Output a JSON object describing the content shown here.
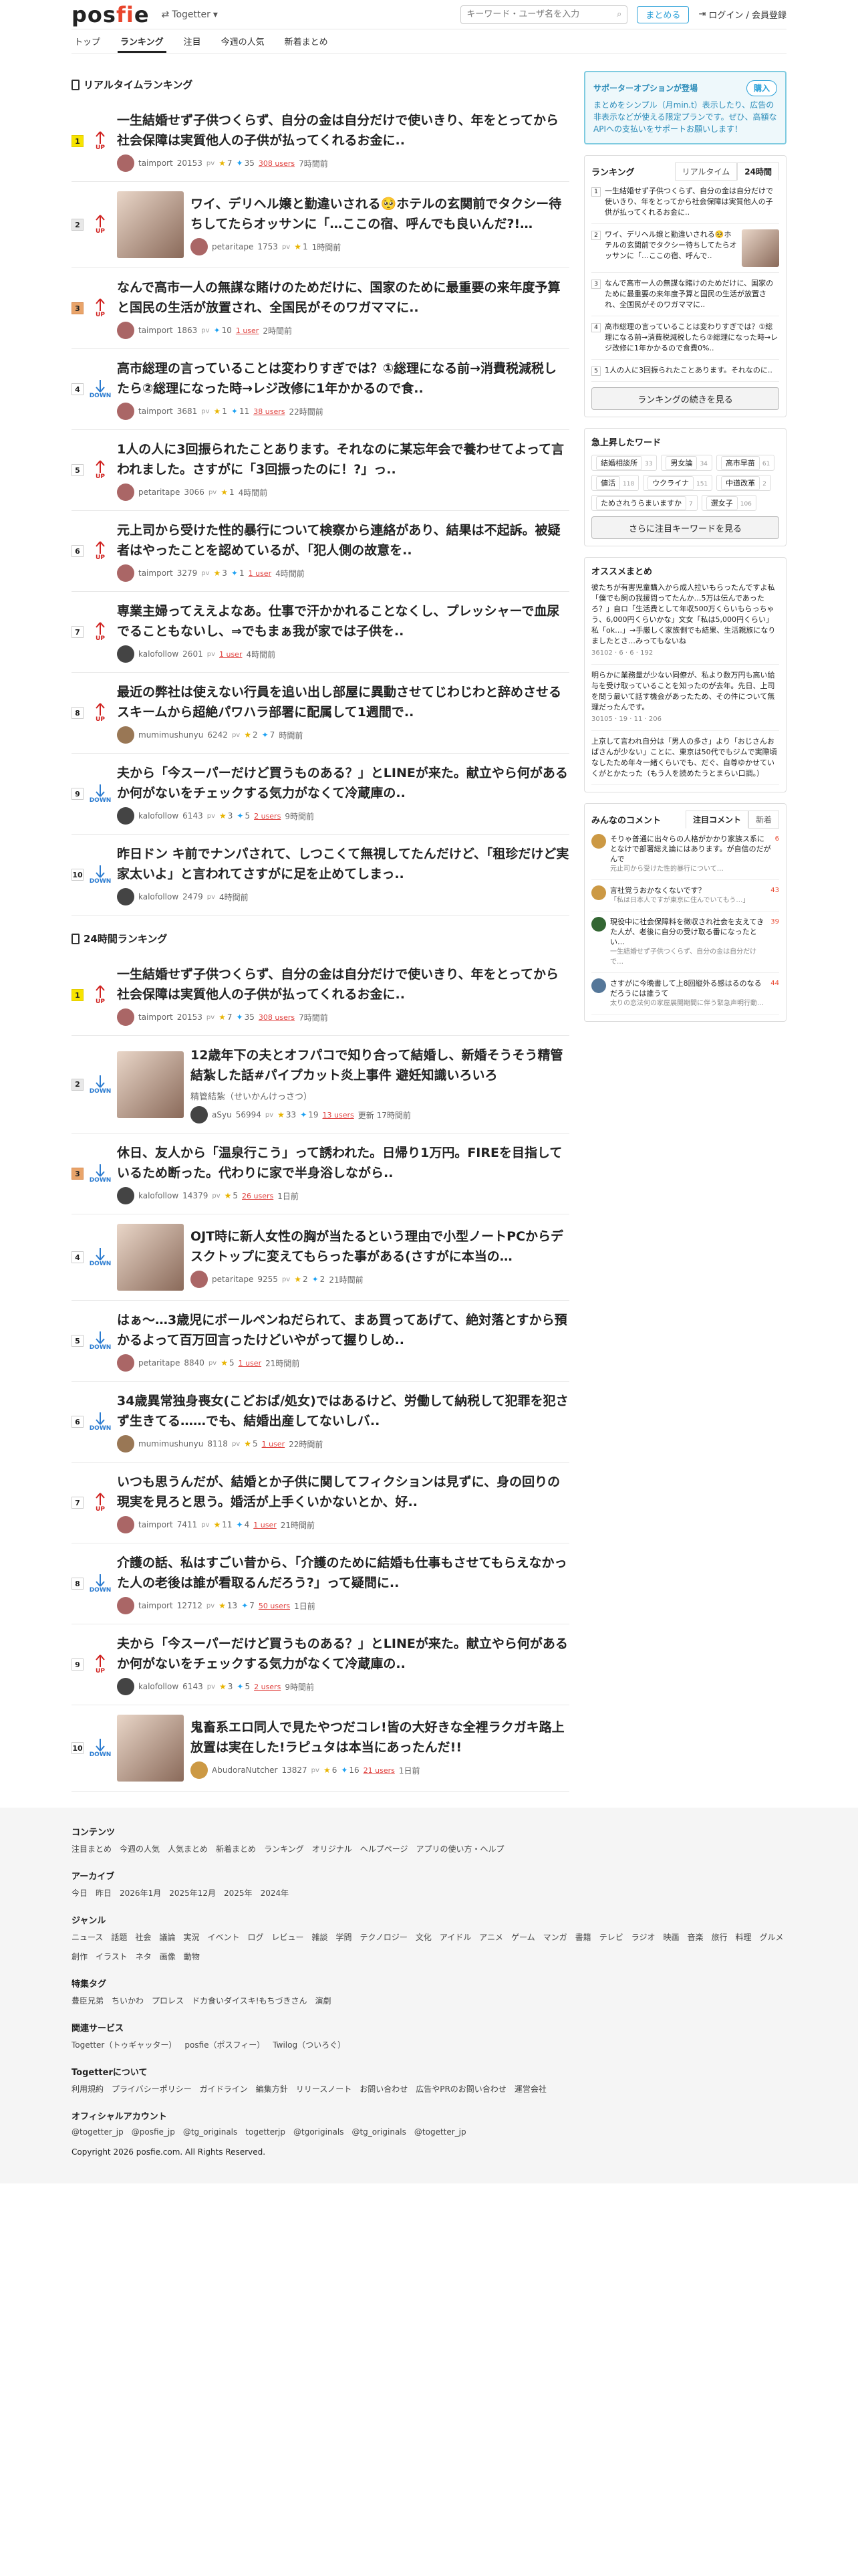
{
  "header": {
    "logo": "posfie",
    "togetter_label": "Togetter",
    "search_placeholder": "キーワード・ユーザ名を入力",
    "matome_button": "まとめる",
    "login_label": "ログイン / 会員登録"
  },
  "nav": [
    "トップ",
    "ランキング",
    "注目",
    "今週の人気",
    "新着まとめ"
  ],
  "realtime": {
    "title": "リアルタイムランキング",
    "items": [
      {
        "rank": "1",
        "dir": "UP",
        "title": "一生結婚せず子供つくらず、自分の金は自分だけで使いきり、年をとってから社会保障は実質他人の子供が払ってくれるお金に..",
        "user": "taimport",
        "pv": "20153",
        "stars": "7",
        "tw": "35",
        "users": "308 users",
        "time": "7時間前",
        "thumb": false
      },
      {
        "rank": "2",
        "dir": "UP",
        "title": "ワイ、デリヘル嬢と勤違いされる🥺ホテルの玄関前でタクシー待ちしてたらオッサンに「…ここの宿、呼んでも良いんだ?!…",
        "user": "petaritape",
        "pv": "1753",
        "stars": "1",
        "tw": "",
        "users": "",
        "time": "1時間前",
        "thumb": true
      },
      {
        "rank": "3",
        "dir": "UP",
        "title": "なんで高市一人の無謀な賭けのためだけに、国家のために最重要の来年度予算と国民の生活が放置され、全国民がそのワガママに..",
        "user": "taimport",
        "pv": "1863",
        "stars": "",
        "tw": "10",
        "users": "1 user",
        "time": "2時間前",
        "thumb": false
      },
      {
        "rank": "4",
        "dir": "DOWN",
        "title": "高市総理の言っていることは変わりすぎでは？①総理になる前→消費税減税したら②総理になった時→レジ改修に1年かかるので食..",
        "user": "taimport",
        "pv": "3681",
        "stars": "1",
        "tw": "11",
        "users": "38 users",
        "time": "22時間前",
        "thumb": false
      },
      {
        "rank": "5",
        "dir": "UP",
        "title": "1人の人に3回振られたことあります。それなのに某忘年会で養わせてよって言われました。さすがに「3回振ったのに！?」っ..",
        "user": "petaritape",
        "pv": "3066",
        "stars": "1",
        "tw": "",
        "users": "",
        "time": "4時間前",
        "thumb": false
      },
      {
        "rank": "6",
        "dir": "UP",
        "title": "元上司から受けた性的暴行について検察から連絡があり、結果は不起訴。被疑者はやったことを認めているが、「犯人側の故意を..",
        "user": "taimport",
        "pv": "3279",
        "stars": "3",
        "tw": "1",
        "users": "1 user",
        "time": "4時間前",
        "thumb": false
      },
      {
        "rank": "7",
        "dir": "UP",
        "title": "専業主婦ってええよなあ。仕事で汗かかれることなくし、プレッシャーで血尿でることもないし、⇒でもまぁ我が家では子供を..",
        "user": "kalofollow",
        "pv": "2601",
        "stars": "",
        "tw": "",
        "users": "1 user",
        "time": "4時間前",
        "thumb": false
      },
      {
        "rank": "8",
        "dir": "UP",
        "title": "最近の弊社は使えない行員を追い出し部屋に異動させてじわじわと辞めさせるスキームから超絶パワハラ部署に配属して1週間で..",
        "user": "mumimushunyu",
        "pv": "6242",
        "stars": "2",
        "tw": "7",
        "users": "",
        "time": "時間前",
        "thumb": false
      },
      {
        "rank": "9",
        "dir": "DOWN",
        "title": "夫から「今スーパーだけど買うものある？」とLINEが来た。献立やら何があるか何がないをチェックする気力がなくて冷蔵庫の..",
        "user": "kalofollow",
        "pv": "6143",
        "stars": "3",
        "tw": "5",
        "users": "2 users",
        "time": "9時間前",
        "thumb": false
      },
      {
        "rank": "10",
        "dir": "DOWN",
        "title": "昨日ドン キ前でナンパされて、しつこくて無視してたんだけど、「租珍だけど実家太いよ」と言われてさすがに足を止めてしまっ..",
        "user": "kalofollow",
        "pv": "2479",
        "stars": "",
        "tw": "",
        "users": "",
        "time": "4時間前",
        "thumb": false
      }
    ]
  },
  "daily": {
    "title": "24時間ランキング",
    "items": [
      {
        "rank": "1",
        "dir": "UP",
        "title": "一生結婚せず子供つくらず、自分の金は自分だけで使いきり、年をとってから社会保障は実質他人の子供が払ってくれるお金に..",
        "user": "taimport",
        "pv": "20153",
        "stars": "7",
        "tw": "35",
        "users": "308 users",
        "time": "7時間前",
        "thumb": false,
        "sub": ""
      },
      {
        "rank": "2",
        "dir": "DOWN",
        "title": "12歳年下の夫とオフパコで知り合って結婚し、新婚そうそう精管結紮した話#パイプカット炎上事件 避妊知識いろいろ",
        "user": "aSyu",
        "pv": "56994",
        "stars": "33",
        "tw": "19",
        "users": "13 users",
        "time": "更新 17時間前",
        "thumb": true,
        "sub": "精管結紮（せいかんけっさつ）"
      },
      {
        "rank": "3",
        "dir": "DOWN",
        "title": "休日、友人から「温泉行こう」って誘われた。日帰り1万円。FIREを目指しているため断った。代わりに家で半身浴しながら..",
        "user": "kalofollow",
        "pv": "14379",
        "stars": "5",
        "tw": "",
        "users": "26 users",
        "time": "1日前",
        "thumb": false,
        "sub": ""
      },
      {
        "rank": "4",
        "dir": "DOWN",
        "title": "OJT時に新人女性の胸が当たるという理由で小型ノートPCからデスクトップに変えてもらった事がある(さすがに本当の…",
        "user": "petaritape",
        "pv": "9255",
        "stars": "2",
        "tw": "2",
        "users": "",
        "time": "21時間前",
        "thumb": true,
        "sub": ""
      },
      {
        "rank": "5",
        "dir": "DOWN",
        "title": "はぁ〜…3歳児にボールペンねだられて、まあ買ってあげて、絶対落とすから預かるよって百万回言ったけどいやがって握りしめ..",
        "user": "petaritape",
        "pv": "8840",
        "stars": "5",
        "tw": "",
        "users": "1 user",
        "time": "21時間前",
        "thumb": false,
        "sub": ""
      },
      {
        "rank": "6",
        "dir": "DOWN",
        "title": "34歳異常独身喪女(こどおば/処女)ではあるけど、労働して納税して犯罪を犯さず生きてる……でも、結婚出産してないしバ..",
        "user": "mumimushunyu",
        "pv": "8118",
        "stars": "5",
        "tw": "",
        "users": "1 user",
        "time": "22時間前",
        "thumb": false,
        "sub": ""
      },
      {
        "rank": "7",
        "dir": "UP",
        "title": "いつも思うんだが、結婚とか子供に関してフィクションは見ずに、身の回りの現実を見ろと思う。婚活が上手くいかないとか、好..",
        "user": "taimport",
        "pv": "7411",
        "stars": "11",
        "tw": "4",
        "users": "1 user",
        "time": "21時間前",
        "thumb": false,
        "sub": ""
      },
      {
        "rank": "8",
        "dir": "DOWN",
        "title": "介護の話、私はすごい昔から、「介護のために結婚も仕事もさせてもらえなかった人の老後は誰が看取るんだろう?」って疑問に..",
        "user": "taimport",
        "pv": "12712",
        "stars": "13",
        "tw": "7",
        "users": "50 users",
        "time": "1日前",
        "thumb": false,
        "sub": ""
      },
      {
        "rank": "9",
        "dir": "UP",
        "title": "夫から「今スーパーだけど買うものある？」とLINEが来た。献立やら何があるか何がないをチェックする気力がなくて冷蔵庫の..",
        "user": "kalofollow",
        "pv": "6143",
        "stars": "3",
        "tw": "5",
        "users": "2 users",
        "time": "9時間前",
        "thumb": false,
        "sub": ""
      },
      {
        "rank": "10",
        "dir": "DOWN",
        "title": "鬼畜系エロ同人で見たやつだコレ!皆の大好きな全裡ラクガキ路上放置は実在した!ラピュタは本当にあったんだ!!",
        "user": "AbudoraNutcher",
        "pv": "13827",
        "stars": "6",
        "tw": "16",
        "users": "21 users",
        "time": "1日前",
        "thumb": true,
        "sub": ""
      }
    ]
  },
  "side": {
    "support_title": "サポーターオプションが登場",
    "support_button": "購入",
    "support_text": "まとめをシンプル（月min.t）表示したり、広告の非表示などが使える限定プランです。ぜひ、高額なAPIへの支払いをサポートお願いします！",
    "ranking_label": "ランキング",
    "tab_realtime": "リアルタイム",
    "tab_24h": "24時間",
    "mini": [
      {
        "n": "1",
        "text": "一生結婚せず子供つくらず、自分の金は自分だけで使いきり、年をとってから社会保障は実質他人の子供が払ってくれるお金に..",
        "thumb": false
      },
      {
        "n": "2",
        "text": "ワイ、デリヘル嬢と勤違いされる🥺ホテルの玄関前でタクシー待ちしてたらオッサンに「…ここの宿、呼んで..",
        "thumb": true
      },
      {
        "n": "3",
        "text": "なんで高市一人の無謀な賭けのためだけに、国家のために最重要の来年度予算と国民の生活が放置され、全国民がそのワガママに..",
        "thumb": false
      },
      {
        "n": "4",
        "text": "高市総理の言っていることは変わりすぎでは？①総理になる前→消費税減税したら②総理になった時→レジ改修に1年かかるので食費0%..",
        "thumb": false
      },
      {
        "n": "5",
        "text": "1人の人に3回振られたことあります。それなのに..",
        "thumb": false
      }
    ],
    "more_ranking": "ランキングの続きを見る",
    "keywords_title": "急上昇したワード",
    "keywords": [
      {
        "w": "結婚相談所",
        "c": "33"
      },
      {
        "w": "男女論",
        "c": "34"
      },
      {
        "w": "高市早苗",
        "c": "61"
      },
      {
        "w": "値活",
        "c": "118"
      },
      {
        "w": "ウクライナ",
        "c": "151"
      },
      {
        "w": "中道改革",
        "c": "2"
      },
      {
        "w": "ためされうらまいますか",
        "c": "7"
      },
      {
        "w": "選女子",
        "c": "106"
      }
    ],
    "more_keywords": "さらに注目キーワードを見る",
    "recommend_title": "オススメまとめ",
    "recommend": [
      {
        "text": "彼たちが有害児童購入から成人拉いもらったんですよ私「僕でも飼の我援問ってたんか…5万は伝んであったろ？」自ロ「生活費として年収500万くらいもらっちゃう、6,000円くらいかな」文女「私は5,000円くらい」私「ok…」→手厳しく家族側でも結果、生活親族になりましたとさ…みってもないね",
        "meta": "36102 · 6 · 6 · 192"
      },
      {
        "text": "明らかに業務量が少ない同僚が、私より数万円も高い給与を受け取っていることを知ったのが去年。先日、上司を問う最いて話す機会があったため、その件について無理だったんです。",
        "meta": "30105 · 19 · 11 · 206"
      },
      {
        "text": "上京して言われ自分は「男人の多さ」より「おじさんおばさんが少ない」ことに、東京は50代でもジムで実際頃なしたため年々一緒くらいでも、だぐ、自尊ゆかせていくがとかたった（もう人を読めたうとまらい口調。）",
        "meta": ""
      }
    ],
    "comments_title": "みんなのコメント",
    "comments_tab1": "注目コメント",
    "comments_tab2": "新着",
    "comments": [
      {
        "text": "そりゃ普通に出々らの人格がかかり家族ス系にとなけで部署総え論にはあります。が自信のだがんで",
        "q": "元止司から受けた性的暴行について…",
        "c": "6"
      },
      {
        "text": "言社覚うおかなくないです？",
        "q": "「私は日本人ですが東京に住んでいてもう…」",
        "c": "43"
      },
      {
        "text": "現役中に社会保障料を徴収され社会を支えてきた人が、老後に自分の受け取る番になったとい…",
        "q": "一生結婚せず子供つくらず、自分の金は自分だけで…",
        "c": "39"
      },
      {
        "text": "さすがに今晩書して上8回縦外る感はるのなるだろうには誰うて",
        "q": "太りの恋法何の家屋展開期間に伴う緊急声明行動…",
        "c": "44"
      }
    ]
  },
  "footer": {
    "sections": [
      {
        "h": "コンテンツ",
        "links": [
          "注目まとめ",
          "今週の人気",
          "人気まとめ",
          "新着まとめ",
          "ランキング",
          "オリジナル",
          "ヘルプページ",
          "アプリの使い方・ヘルプ"
        ]
      },
      {
        "h": "アーカイブ",
        "links": [
          "今日",
          "昨日",
          "2026年1月",
          "2025年12月",
          "2025年",
          "2024年"
        ]
      },
      {
        "h": "ジャンル",
        "links": [
          "ニュース",
          "話題",
          "社会",
          "議論",
          "実況",
          "イベント",
          "ログ",
          "レビュー",
          "雑談",
          "学問",
          "テクノロジー",
          "文化",
          "アイドル",
          "アニメ",
          "ゲーム",
          "マンガ",
          "書籍",
          "テレビ",
          "ラジオ",
          "映画",
          "音楽",
          "旅行",
          "料理",
          "グルメ",
          "創作",
          "イラスト",
          "ネタ",
          "画像",
          "動物"
        ]
      },
      {
        "h": "特集タグ",
        "links": [
          "豊臣兄弟",
          "ちいかわ",
          "プロレス",
          "ドカ食いダイスキ!もちづきさん",
          "演劇"
        ]
      },
      {
        "h": "関連サービス",
        "links": [
          "Togetter（トゥギャッター）",
          "posfie（ポスフィー）",
          "Twilog（ついろぐ）"
        ]
      },
      {
        "h": "Togetterについて",
        "links": [
          "利用規約",
          "プライバシーポリシー",
          "ガイドライン",
          "編集方針",
          "リリースノート",
          "お問い合わせ",
          "広告やPRのお問い合わせ",
          "運営会社"
        ]
      },
      {
        "h": "オフィシャルアカウント",
        "links": [
          "@togetter_jp",
          "@posfie_jp",
          "@tg_originals",
          "togetterjp",
          "@tgoriginals",
          "@tg_originals",
          "@togetter_jp"
        ]
      }
    ],
    "copyright": "Copyright 2026 posfie.com. All Rights Reserved."
  }
}
